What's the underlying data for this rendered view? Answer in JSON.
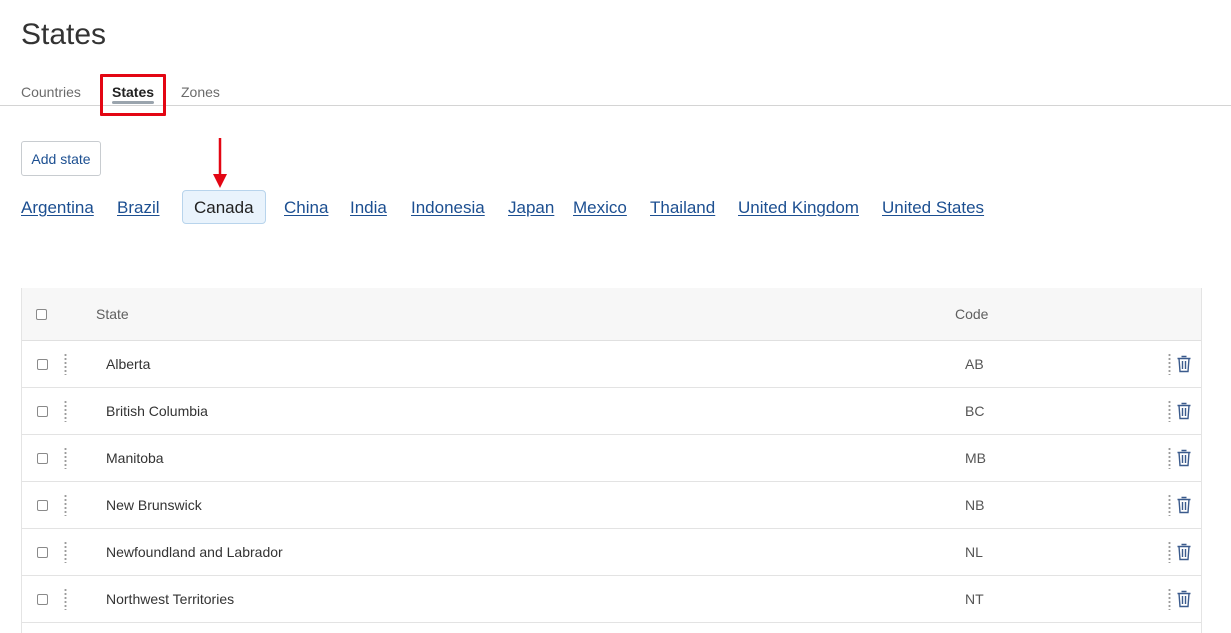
{
  "page": {
    "title": "States"
  },
  "tabs": [
    {
      "label": "Countries",
      "active": false
    },
    {
      "label": "States",
      "active": true
    },
    {
      "label": "Zones",
      "active": false
    }
  ],
  "add_button": {
    "label": "Add state"
  },
  "countries": {
    "items": [
      "Argentina",
      "Brazil",
      "Canada",
      "China",
      "India",
      "Indonesia",
      "Japan",
      "Mexico",
      "Thailand",
      "United Kingdom",
      "United States"
    ],
    "selected": "Canada"
  },
  "table": {
    "headers": {
      "state": "State",
      "code": "Code"
    },
    "rows": [
      {
        "name": "Alberta",
        "code": "AB"
      },
      {
        "name": "British Columbia",
        "code": "BC"
      },
      {
        "name": "Manitoba",
        "code": "MB"
      },
      {
        "name": "New Brunswick",
        "code": "NB"
      },
      {
        "name": "Newfoundland and Labrador",
        "code": "NL"
      },
      {
        "name": "Northwest Territories",
        "code": "NT"
      }
    ]
  },
  "colors": {
    "link": "#1c4f91",
    "annotation_red": "#e30613",
    "selected_chip_bg": "#e9f3fc",
    "trash_icon": "#3a5a8c"
  },
  "icons": [
    "drag-handle-icon",
    "more-options-icon",
    "trash-icon",
    "down-arrow-icon"
  ]
}
